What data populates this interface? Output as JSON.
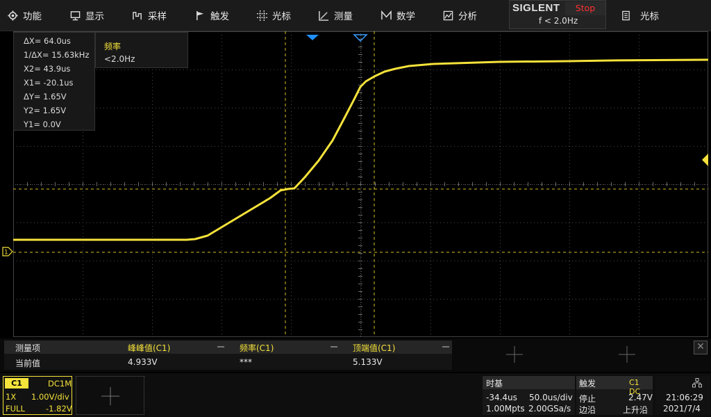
{
  "menu": [
    {
      "label": "功能",
      "icon": "gear-icon"
    },
    {
      "label": "显示",
      "icon": "display-icon"
    },
    {
      "label": "采样",
      "icon": "acquire-icon"
    },
    {
      "label": "触发",
      "icon": "trigger-flag-icon"
    },
    {
      "label": "光标",
      "icon": "cursor-icon"
    },
    {
      "label": "测量",
      "icon": "measure-icon"
    },
    {
      "label": "数学",
      "icon": "math-icon"
    },
    {
      "label": "分析",
      "icon": "analysis-icon"
    }
  ],
  "brand": {
    "name": "SIGLENT",
    "status": "Stop",
    "freq": "f < 2.0Hz",
    "status_color": "#ff3030"
  },
  "right_menu": {
    "label": "光标",
    "icon": "cursor-doc-icon"
  },
  "cursor_info": {
    "dx": "ΔX= 64.0us",
    "inv_dx": "1/ΔX= 15.63kHz",
    "x2": "X2= 43.9us",
    "x1": "X1= -20.1us",
    "dy": "ΔY= 1.65V",
    "y2": "Y2= 1.65V",
    "y1": "Y1= 0.0V"
  },
  "freq_box": {
    "title": "频率",
    "value": "<2.0Hz"
  },
  "measurements": {
    "header": "测量项",
    "row_label": "当前值",
    "items": [
      {
        "name": "峰峰值(C1)",
        "value": "4.933V"
      },
      {
        "name": "频率(C1)",
        "value": "***"
      },
      {
        "name": "顶端值(C1)",
        "value": "5.133V"
      }
    ]
  },
  "channel1": {
    "tag": "C1",
    "coupling": "DC1M",
    "probe": "1X",
    "scale": "1.00V/div",
    "bandwidth": "FULL",
    "offset": "-1.82V",
    "color": "#f5e23a"
  },
  "timebase": {
    "title": "时基",
    "delay": "-34.4us",
    "scale": "50.0us/div",
    "memory": "1.00Mpts",
    "sample_rate": "2.00GSa/s"
  },
  "trigger": {
    "title": "触发",
    "source": "C1 DC",
    "state": "停止",
    "level": "2.47V",
    "type": "边沿",
    "slope": "上升沿"
  },
  "clock": {
    "time": "21:06:29",
    "date": "2021/7/4"
  },
  "markers": {
    "ground": "1",
    "trigger_level": "2"
  }
}
